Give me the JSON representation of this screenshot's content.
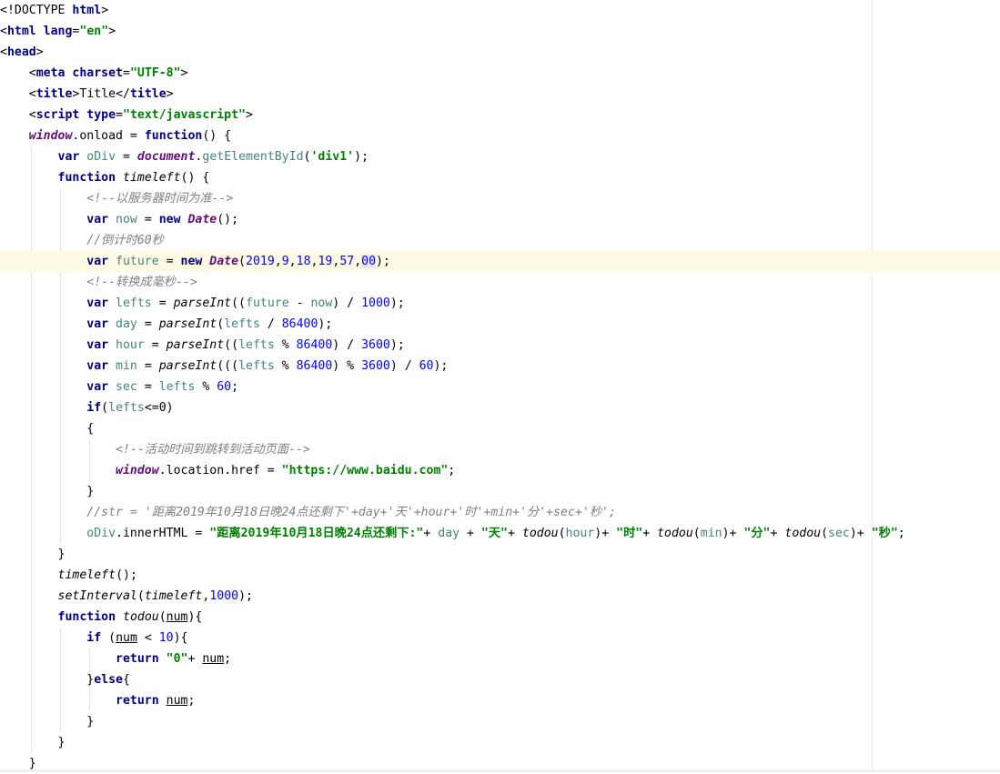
{
  "editor": {
    "language": "html",
    "lines": [
      [
        {
          "t": "<",
          "c": "punc"
        },
        {
          "t": "!DOCTYPE ",
          "c": "punc"
        },
        {
          "t": "html",
          "c": "tag"
        },
        {
          "t": ">",
          "c": "punc"
        }
      ],
      [
        {
          "t": "<",
          "c": "punc"
        },
        {
          "t": "html ",
          "c": "tag"
        },
        {
          "t": "lang",
          "c": "tag"
        },
        {
          "t": "=",
          "c": "punc"
        },
        {
          "t": "\"en\"",
          "c": "str"
        },
        {
          "t": ">",
          "c": "punc"
        }
      ],
      [
        {
          "t": "<",
          "c": "punc"
        },
        {
          "t": "head",
          "c": "tag"
        },
        {
          "t": ">",
          "c": "punc"
        }
      ],
      [
        {
          "t": "    "
        },
        {
          "t": "<",
          "c": "punc"
        },
        {
          "t": "meta ",
          "c": "tag"
        },
        {
          "t": "charset",
          "c": "tag"
        },
        {
          "t": "=",
          "c": "punc"
        },
        {
          "t": "\"UTF-8\"",
          "c": "str"
        },
        {
          "t": ">",
          "c": "punc"
        }
      ],
      [
        {
          "t": "    "
        },
        {
          "t": "<",
          "c": "punc"
        },
        {
          "t": "title",
          "c": "tag"
        },
        {
          "t": ">",
          "c": "punc"
        },
        {
          "t": "Title",
          "c": "punc"
        },
        {
          "t": "</",
          "c": "punc"
        },
        {
          "t": "title",
          "c": "tag"
        },
        {
          "t": ">",
          "c": "punc"
        }
      ],
      [
        {
          "t": "    "
        },
        {
          "t": "<",
          "c": "punc"
        },
        {
          "t": "script ",
          "c": "tag"
        },
        {
          "t": "type",
          "c": "tag"
        },
        {
          "t": "=",
          "c": "punc"
        },
        {
          "t": "\"text/javascript\"",
          "c": "str"
        },
        {
          "t": ">",
          "c": "punc"
        }
      ],
      [
        {
          "t": "    "
        },
        {
          "t": "window",
          "c": "glob"
        },
        {
          "t": ".onload = "
        },
        {
          "t": "function",
          "c": "kw"
        },
        {
          "t": "() {"
        }
      ],
      [
        {
          "t": "        "
        },
        {
          "t": "var ",
          "c": "kw"
        },
        {
          "t": "oDiv",
          "c": "var"
        },
        {
          "t": " = "
        },
        {
          "t": "document",
          "c": "glob"
        },
        {
          "t": "."
        },
        {
          "t": "getElementById",
          "c": "var"
        },
        {
          "t": "("
        },
        {
          "t": "'div1'",
          "c": "str"
        },
        {
          "t": ");"
        }
      ],
      [
        {
          "t": "        "
        },
        {
          "t": "function ",
          "c": "kw"
        },
        {
          "t": "timeleft",
          "c": "fn"
        },
        {
          "t": "() {"
        }
      ],
      [
        {
          "t": "            "
        },
        {
          "t": "<!--以服务器时间为准-->",
          "c": "cmt"
        }
      ],
      [
        {
          "t": "            "
        },
        {
          "t": "var ",
          "c": "kw"
        },
        {
          "t": "now",
          "c": "var"
        },
        {
          "t": " = "
        },
        {
          "t": "new ",
          "c": "kw"
        },
        {
          "t": "Date",
          "c": "glob"
        },
        {
          "t": "();"
        }
      ],
      [
        {
          "t": "            "
        },
        {
          "t": "//倒计时60秒",
          "c": "cmt"
        }
      ],
      [
        {
          "t": "            "
        },
        {
          "t": "var ",
          "c": "kw"
        },
        {
          "t": "future",
          "c": "var"
        },
        {
          "t": " = "
        },
        {
          "t": "new ",
          "c": "kw"
        },
        {
          "t": "Date",
          "c": "glob"
        },
        {
          "t": "("
        },
        {
          "t": "2019",
          "c": "num"
        },
        {
          "t": ","
        },
        {
          "t": "9",
          "c": "num"
        },
        {
          "t": ","
        },
        {
          "t": "18",
          "c": "num"
        },
        {
          "t": ","
        },
        {
          "t": "19",
          "c": "num"
        },
        {
          "t": ","
        },
        {
          "t": "57",
          "c": "num"
        },
        {
          "t": ","
        },
        {
          "t": "00",
          "c": "num match"
        },
        {
          "t": ");"
        }
      ],
      [
        {
          "t": "            "
        },
        {
          "t": "<!--转换成毫秒-->",
          "c": "cmt"
        }
      ],
      [
        {
          "t": "            "
        },
        {
          "t": "var ",
          "c": "kw"
        },
        {
          "t": "lefts",
          "c": "var"
        },
        {
          "t": " = "
        },
        {
          "t": "parseInt",
          "c": "fn"
        },
        {
          "t": "(("
        },
        {
          "t": "future",
          "c": "var"
        },
        {
          "t": " - "
        },
        {
          "t": "now",
          "c": "var"
        },
        {
          "t": ") / "
        },
        {
          "t": "1000",
          "c": "num"
        },
        {
          "t": ");"
        }
      ],
      [
        {
          "t": "            "
        },
        {
          "t": "var ",
          "c": "kw"
        },
        {
          "t": "day",
          "c": "var"
        },
        {
          "t": " = "
        },
        {
          "t": "parseInt",
          "c": "fn"
        },
        {
          "t": "("
        },
        {
          "t": "lefts",
          "c": "var"
        },
        {
          "t": " / "
        },
        {
          "t": "86400",
          "c": "num"
        },
        {
          "t": ");"
        }
      ],
      [
        {
          "t": "            "
        },
        {
          "t": "var ",
          "c": "kw"
        },
        {
          "t": "hour",
          "c": "var"
        },
        {
          "t": " = "
        },
        {
          "t": "parseInt",
          "c": "fn"
        },
        {
          "t": "(("
        },
        {
          "t": "lefts",
          "c": "var"
        },
        {
          "t": " % "
        },
        {
          "t": "86400",
          "c": "num"
        },
        {
          "t": ") / "
        },
        {
          "t": "3600",
          "c": "num"
        },
        {
          "t": ");"
        }
      ],
      [
        {
          "t": "            "
        },
        {
          "t": "var ",
          "c": "kw"
        },
        {
          "t": "min",
          "c": "var"
        },
        {
          "t": " = "
        },
        {
          "t": "parseInt",
          "c": "fn"
        },
        {
          "t": "((("
        },
        {
          "t": "lefts",
          "c": "var"
        },
        {
          "t": " % "
        },
        {
          "t": "86400",
          "c": "num"
        },
        {
          "t": ") % "
        },
        {
          "t": "3600",
          "c": "num"
        },
        {
          "t": ") / "
        },
        {
          "t": "60",
          "c": "num"
        },
        {
          "t": ");"
        }
      ],
      [
        {
          "t": "            "
        },
        {
          "t": "var ",
          "c": "kw"
        },
        {
          "t": "sec",
          "c": "var"
        },
        {
          "t": " = "
        },
        {
          "t": "lefts",
          "c": "var"
        },
        {
          "t": " % "
        },
        {
          "t": "60",
          "c": "num"
        },
        {
          "t": ";"
        }
      ],
      [
        {
          "t": "            "
        },
        {
          "t": "if",
          "c": "kw"
        },
        {
          "t": "("
        },
        {
          "t": "lefts",
          "c": "var"
        },
        {
          "t": "<=0)"
        }
      ],
      [
        {
          "t": "            "
        },
        {
          "t": "{"
        }
      ],
      [
        {
          "t": "                "
        },
        {
          "t": "<!--活动时间到跳转到活动页面-->",
          "c": "cmt"
        }
      ],
      [
        {
          "t": "                "
        },
        {
          "t": "window",
          "c": "glob"
        },
        {
          "t": ".location.href = "
        },
        {
          "t": "\"https://www.baidu.com\"",
          "c": "str"
        },
        {
          "t": ";"
        }
      ],
      [
        {
          "t": "            "
        },
        {
          "t": "}"
        }
      ],
      [
        {
          "t": "            "
        },
        {
          "t": "//str = '距离2019年10月18日晚24点还剩下'+day+'天'+hour+'时'+min+'分'+sec+'秒';",
          "c": "cmt"
        }
      ],
      [
        {
          "t": "            "
        },
        {
          "t": "oDiv",
          "c": "var"
        },
        {
          "t": ".innerHTML = "
        },
        {
          "t": "\"距离2019年10月18日晚24点还剩下:\"",
          "c": "str"
        },
        {
          "t": "+ "
        },
        {
          "t": "day",
          "c": "var"
        },
        {
          "t": " + "
        },
        {
          "t": "\"天\"",
          "c": "str"
        },
        {
          "t": "+ "
        },
        {
          "t": "todou",
          "c": "fn"
        },
        {
          "t": "("
        },
        {
          "t": "hour",
          "c": "var"
        },
        {
          "t": ")+ "
        },
        {
          "t": "\"时\"",
          "c": "str"
        },
        {
          "t": "+ "
        },
        {
          "t": "todou",
          "c": "fn"
        },
        {
          "t": "("
        },
        {
          "t": "min",
          "c": "var"
        },
        {
          "t": ")+ "
        },
        {
          "t": "\"分\"",
          "c": "str"
        },
        {
          "t": "+ "
        },
        {
          "t": "todou",
          "c": "fn"
        },
        {
          "t": "("
        },
        {
          "t": "sec",
          "c": "var"
        },
        {
          "t": ")+ "
        },
        {
          "t": "\"秒\"",
          "c": "str"
        },
        {
          "t": ";"
        }
      ],
      [
        {
          "t": "        "
        },
        {
          "t": "}"
        }
      ],
      [
        {
          "t": "        "
        },
        {
          "t": "timeleft",
          "c": "fn"
        },
        {
          "t": "();"
        }
      ],
      [
        {
          "t": "        "
        },
        {
          "t": "setInterval",
          "c": "fn"
        },
        {
          "t": "("
        },
        {
          "t": "timeleft",
          "c": "fn"
        },
        {
          "t": ","
        },
        {
          "t": "1000",
          "c": "num"
        },
        {
          "t": ");"
        }
      ],
      [
        {
          "t": "        "
        },
        {
          "t": "function ",
          "c": "kw"
        },
        {
          "t": "todou",
          "c": "fn"
        },
        {
          "t": "("
        },
        {
          "t": "num",
          "c": "prm"
        },
        {
          "t": "){"
        }
      ],
      [
        {
          "t": "            "
        },
        {
          "t": "if ",
          "c": "kw"
        },
        {
          "t": "("
        },
        {
          "t": "num",
          "c": "prm"
        },
        {
          "t": " < "
        },
        {
          "t": "10",
          "c": "num"
        },
        {
          "t": "){"
        }
      ],
      [
        {
          "t": "                "
        },
        {
          "t": "return ",
          "c": "kw"
        },
        {
          "t": "\"0\"",
          "c": "str"
        },
        {
          "t": "+ "
        },
        {
          "t": "num",
          "c": "prm"
        },
        {
          "t": ";"
        }
      ],
      [
        {
          "t": "            "
        },
        {
          "t": "}"
        },
        {
          "t": "else",
          "c": "kw"
        },
        {
          "t": "{"
        }
      ],
      [
        {
          "t": "                "
        },
        {
          "t": "return ",
          "c": "kw"
        },
        {
          "t": "num",
          "c": "prm"
        },
        {
          "t": ";"
        }
      ],
      [
        {
          "t": "            "
        },
        {
          "t": "}"
        }
      ],
      [
        {
          "t": "        "
        },
        {
          "t": "}"
        }
      ],
      [
        {
          "t": "    "
        },
        {
          "t": "}"
        }
      ]
    ],
    "caret_line": 13
  }
}
